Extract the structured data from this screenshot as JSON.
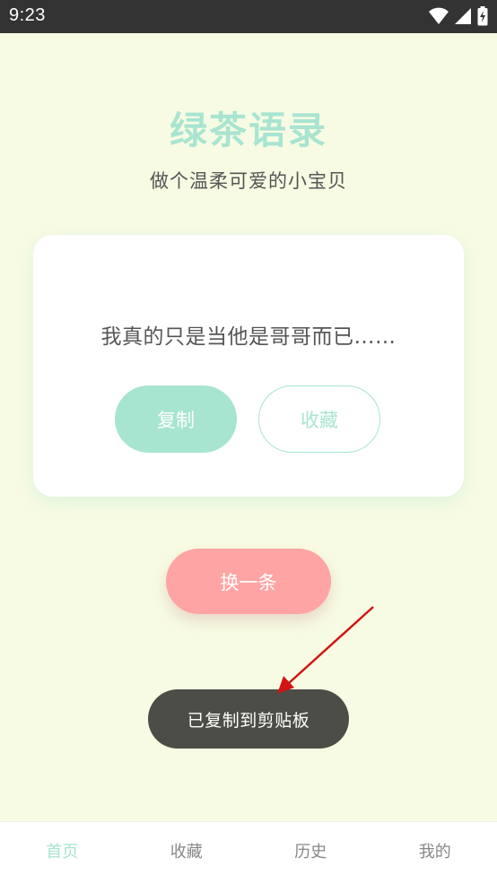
{
  "status_bar": {
    "time": "9:23",
    "icons": [
      "wifi-icon",
      "signal-icon",
      "battery-icon"
    ]
  },
  "header": {
    "title": "绿茶语录",
    "subtitle": "做个温柔可爱的小宝贝"
  },
  "card": {
    "quote": "我真的只是当他是哥哥而已……",
    "copy_label": "复制",
    "favorite_label": "收藏"
  },
  "actions": {
    "next_label": "换一条"
  },
  "toast": {
    "message": "已复制到剪贴板"
  },
  "bottom_nav": {
    "items": [
      {
        "label": "首页",
        "active": true
      },
      {
        "label": "收藏",
        "active": false
      },
      {
        "label": "历史",
        "active": false
      },
      {
        "label": "我的",
        "active": false
      }
    ]
  },
  "colors": {
    "background": "#f8fbe3",
    "accent": "#a8e5d0",
    "next_button": "#ffa4a4",
    "toast": "#4d4d47",
    "annotation_arrow": "#d11414"
  }
}
